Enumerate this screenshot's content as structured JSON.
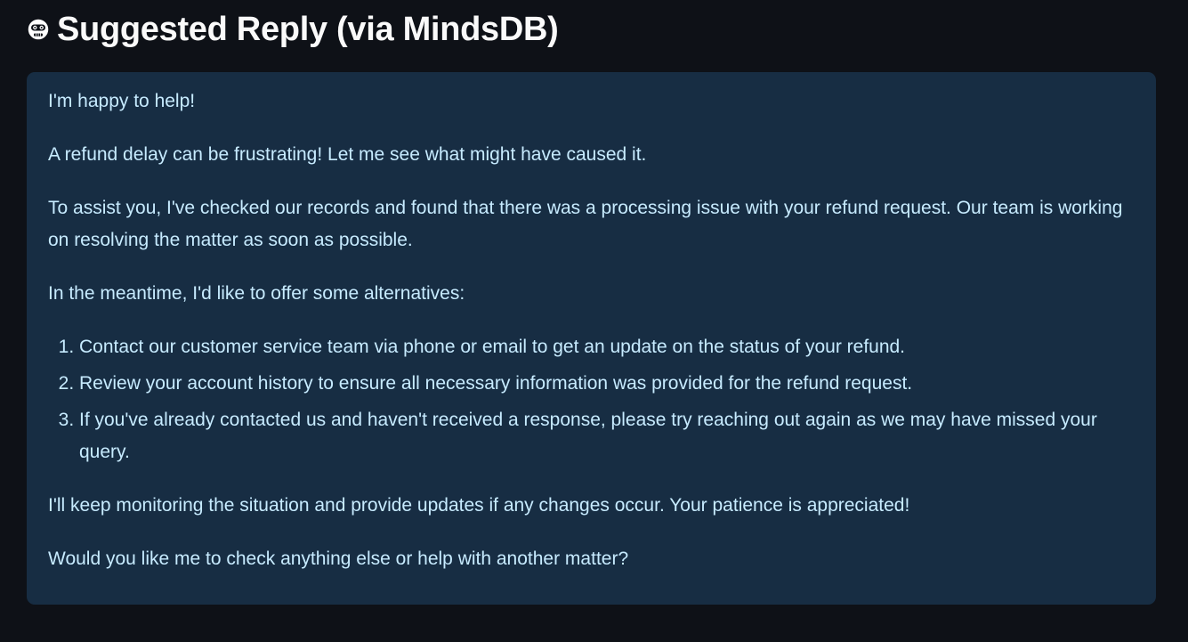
{
  "header": {
    "icon": "robot-face-icon",
    "title": "Suggested Reply (via MindsDB)"
  },
  "reply": {
    "greeting": "I'm happy to help!",
    "paragraph_1": "A refund delay can be frustrating! Let me see what might have caused it.",
    "paragraph_2": "To assist you, I've checked our records and found that there was a processing issue with your refund request. Our team is working on resolving the matter as soon as possible.",
    "paragraph_3": "In the meantime, I'd like to offer some alternatives:",
    "alternatives": [
      "Contact our customer service team via phone or email to get an update on the status of your refund.",
      "Review your account history to ensure all necessary information was provided for the refund request.",
      "If you've already contacted us and haven't received a response, please try reaching out again as we may have missed your query."
    ],
    "paragraph_4": "I'll keep monitoring the situation and provide updates if any changes occur. Your patience is appreciated!",
    "closing": "Would you like me to check anything else or help with another matter?"
  },
  "colors": {
    "background": "#0e1117",
    "box_background": "#172d43",
    "box_text": "#c7ebff",
    "heading_text": "#fafafa"
  }
}
